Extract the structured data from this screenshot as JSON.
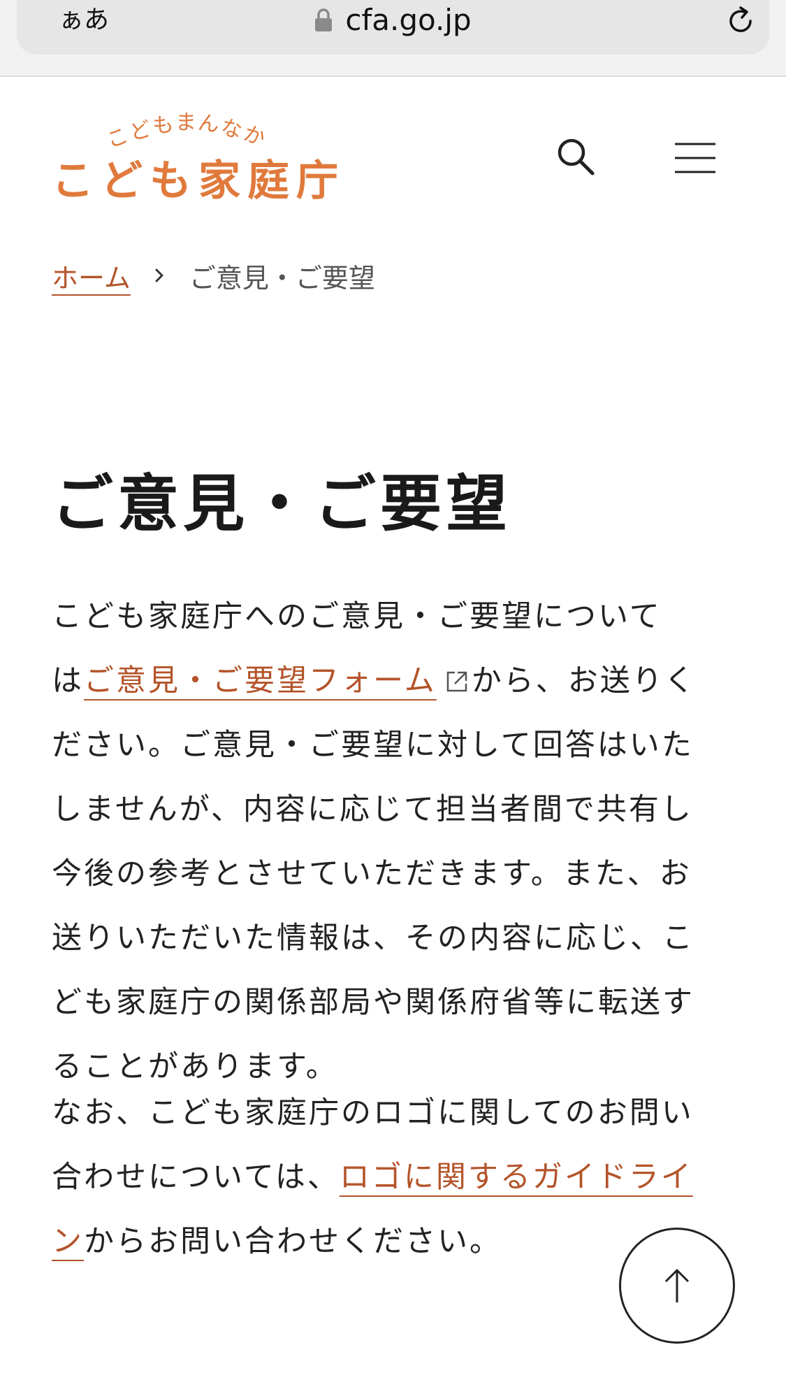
{
  "browser": {
    "text_size_label": "ぁあ",
    "url": "cfa.go.jp"
  },
  "header": {
    "logo_tagline": [
      "こ",
      "ど",
      "も",
      "ま",
      "ん",
      "な",
      "か"
    ],
    "logo_name": "こども家庭庁"
  },
  "breadcrumb": {
    "home": "ホーム",
    "current": "ご意見・ご要望"
  },
  "main": {
    "title": "ご意見・ご要望",
    "para1": {
      "line1": "こども家庭庁へのご意見・ご要望について",
      "prefix": "は",
      "link": "ご意見・ご要望フォーム",
      "suffix": "から、お送りください。ご意見・ご要望に対して回答はいたしませんが、内容に応じて担当者間で共有し今後の参考とさせていただきます。また、お送りいただいた情報は、その内容に応じ、こども家庭庁の関係部局や関係府省等に転送することがあります。"
    },
    "para2": {
      "prefix": "なお、こども家庭庁のロゴに関してのお問い合わせについては、",
      "link": "ロゴに関するガイドライン",
      "suffix": "からお問い合わせください。"
    }
  },
  "colors": {
    "brand": "#e07a3c",
    "link": "#b4542a"
  }
}
